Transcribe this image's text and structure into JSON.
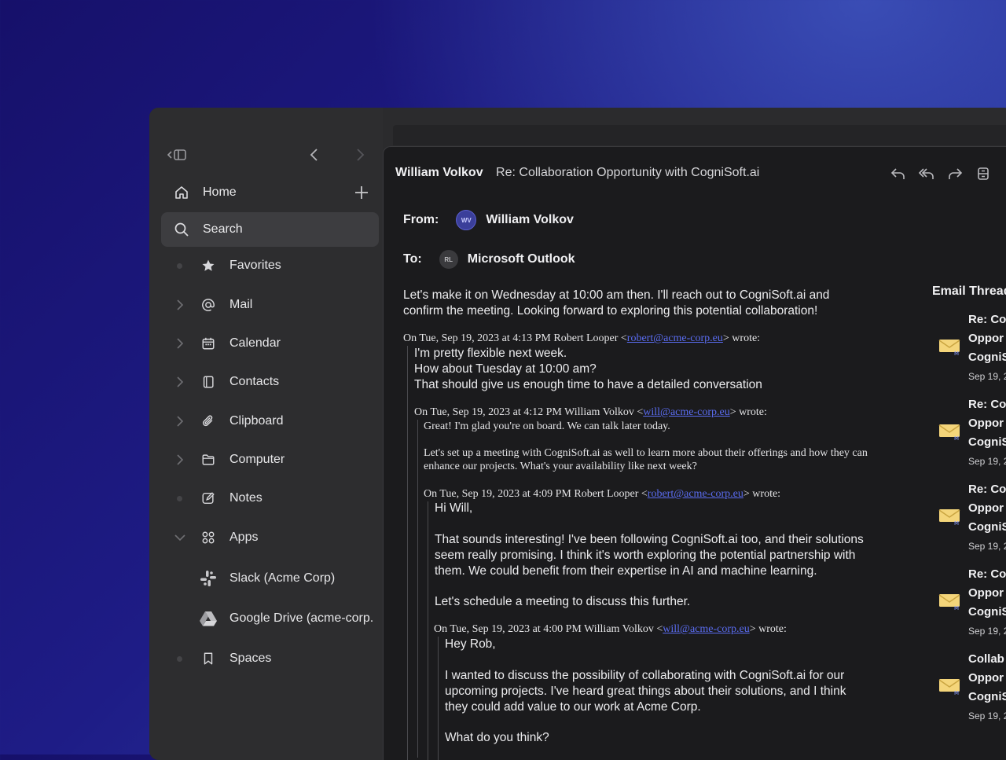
{
  "sidebar": {
    "home_label": "Home",
    "search_label": "Search",
    "items": [
      {
        "label": "Favorites",
        "icon": "star-icon",
        "expander": "dot"
      },
      {
        "label": "Mail",
        "icon": "at-icon",
        "expander": "chevron"
      },
      {
        "label": "Calendar",
        "icon": "calendar-icon",
        "expander": "chevron"
      },
      {
        "label": "Contacts",
        "icon": "contacts-book-icon",
        "expander": "chevron"
      },
      {
        "label": "Clipboard",
        "icon": "paperclip-icon",
        "expander": "chevron"
      },
      {
        "label": "Computer",
        "icon": "folder-icon",
        "expander": "chevron"
      },
      {
        "label": "Notes",
        "icon": "edit-note-icon",
        "expander": "dot"
      },
      {
        "label": "Apps",
        "icon": "apps-grid-icon",
        "expander": "chevron-down"
      }
    ],
    "apps": [
      {
        "label": "Slack (Acme Corp)",
        "icon": "slack-icon"
      },
      {
        "label": "Google Drive (acme-corp.",
        "icon": "google-drive-icon"
      }
    ],
    "spaces_label": "Spaces"
  },
  "email": {
    "sender": "William Volkov",
    "subject": "Re: Collaboration Opportunity with CogniSoft.ai",
    "from_label": "From:",
    "from_initials": "WV",
    "from_name": "William Volkov",
    "to_label": "To:",
    "to_initials": "RL",
    "to_name": "Microsoft Outlook",
    "body_lines": [
      "Let's make it on Wednesday at 10:00 am then. I'll reach out to CogniSoft.ai and",
      "confirm the meeting. Looking forward to exploring this potential collaboration!"
    ],
    "quote1": {
      "prefix": "On Tue, Sep 19, 2023 at 4:13 PM Robert Looper <",
      "email": "robert@acme-corp.eu",
      "suffix": "> wrote:",
      "lines": [
        "I'm pretty flexible next week.",
        "How about Tuesday at 10:00 am?",
        "That should give us enough time to have a detailed conversation"
      ]
    },
    "quote2": {
      "prefix": "On Tue, Sep 19, 2023 at 4:12 PM William Volkov <",
      "email": "will@acme-corp.eu",
      "suffix": "> wrote:",
      "line1": "Great! I'm glad you're on board. We can talk later today.",
      "line2": "Let's set up a meeting with CogniSoft.ai as well to learn more about their offerings and how they can",
      "line3": "enhance our projects. What's your availability like next week?"
    },
    "quote3": {
      "prefix": "On Tue, Sep 19, 2023 at 4:09 PM Robert Looper <",
      "email": "robert@acme-corp.eu",
      "suffix": "> wrote:",
      "greeting": "Hi Will,",
      "p1": [
        "That sounds interesting! I've been following CogniSoft.ai too, and their solutions",
        "seem really promising. I think it's worth exploring the potential partnership with",
        "them. We could benefit from their expertise in AI and machine learning."
      ],
      "p2": "Let's schedule a meeting to discuss this further."
    },
    "quote4": {
      "prefix": "On Tue, Sep 19, 2023 at 4:00 PM William Volkov <",
      "email": "will@acme-corp.eu",
      "suffix": "> wrote:",
      "greeting": "Hey Rob,",
      "p1": [
        "I wanted to discuss the possibility of collaborating with CogniSoft.ai for our",
        "upcoming projects. I've heard great things about their solutions, and I think",
        "they could add value to our work at Acme Corp."
      ],
      "p2": "What do you think?"
    }
  },
  "thread": {
    "title": "Email Thread",
    "items": [
      {
        "l1": "Re: Co",
        "l2": "Oppor",
        "l3": "CogniS",
        "date": "Sep 19, 2"
      },
      {
        "l1": "Re: Co",
        "l2": "Oppor",
        "l3": "CogniS",
        "date": "Sep 19, 2"
      },
      {
        "l1": "Re: Co",
        "l2": "Oppor",
        "l3": "CogniS",
        "date": "Sep 19, 2"
      },
      {
        "l1": "Re: Co",
        "l2": "Oppor",
        "l3": "CogniS",
        "date": "Sep 19, 2"
      },
      {
        "l1": "Collab",
        "l2": "Oppor",
        "l3": "CogniS",
        "date": "Sep 19, 2"
      }
    ]
  },
  "colors": {
    "accent_link": "#5a6cf0",
    "avatar_wv": "#3b3f9a",
    "avatar_rl": "#3a3a3d"
  }
}
